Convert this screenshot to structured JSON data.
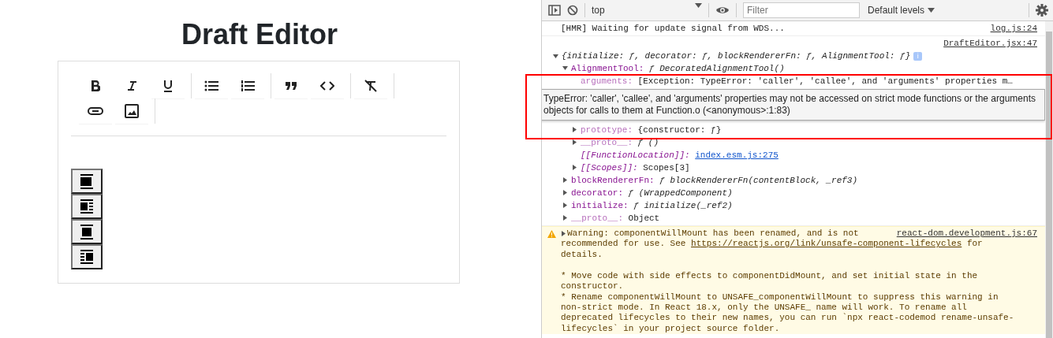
{
  "editor": {
    "title": "Draft Editor",
    "toolbar_rows": [
      [
        [
          {
            "kind": "bold"
          },
          {
            "kind": "italic"
          },
          {
            "kind": "underline"
          }
        ],
        [
          {
            "kind": "bullets"
          },
          {
            "kind": "numbers"
          }
        ],
        [
          {
            "kind": "quote"
          },
          {
            "kind": "code"
          }
        ],
        [
          {
            "kind": "clear"
          }
        ]
      ],
      [
        [
          {
            "kind": "link"
          },
          {
            "kind": "image"
          }
        ]
      ]
    ],
    "align_buttons": [
      {
        "kind": "full"
      },
      {
        "kind": "left"
      },
      {
        "kind": "center"
      },
      {
        "kind": "right"
      }
    ]
  },
  "devtools": {
    "context": "top",
    "filter": {
      "placeholder": "Filter"
    },
    "levels": "Default levels",
    "messages": [
      {
        "kind": "log",
        "text": "[HMR] Waiting for update signal from WDS...",
        "source": "log.js:24"
      },
      {
        "kind": "object",
        "source": "DraftEditor.jsx:47",
        "summary": "{initialize: ƒ, decorator: ƒ, blockRendererFn: ƒ, AlignmentTool: ƒ}",
        "badge": "i",
        "expanded": true,
        "children": [
          {
            "key": "AlignmentTool:",
            "value": "ƒ DecoratedAlignmentTool()",
            "expandable": true,
            "expanded": true,
            "faded": false,
            "kind": "function",
            "children": [
              {
                "key": "arguments:",
                "value": "[Exception: TypeError: 'caller', 'callee', and 'arguments' properties m…",
                "expandable": false,
                "expanded": false,
                "faded": true,
                "kind": "plain",
                "tooltip": "TypeError: 'caller', 'callee', and 'arguments' properties may not be accessed on strict mode functions or the arguments objects for calls to them at Function.o (<anonymous>:1:83)"
              },
              {
                "key": "prototype:",
                "value": "{constructor: ƒ}",
                "expandable": true,
                "expanded": false,
                "faded": true,
                "kind": "plain"
              },
              {
                "key": "__proto__:",
                "value": "ƒ ()",
                "expandable": true,
                "expanded": false,
                "faded": true,
                "kind": "function"
              },
              {
                "key": "[[FunctionLocation]]:",
                "value": "index.esm.js:275",
                "expandable": false,
                "expanded": false,
                "faded": false,
                "kind": "link"
              },
              {
                "key": "[[Scopes]]:",
                "value": "Scopes[3]",
                "expandable": true,
                "expanded": false,
                "faded": false,
                "kind": "plain"
              }
            ]
          },
          {
            "key": "blockRendererFn:",
            "value": "ƒ blockRendererFn(contentBlock, _ref3)",
            "expandable": true,
            "expanded": false,
            "faded": false,
            "kind": "function"
          },
          {
            "key": "decorator:",
            "value": "ƒ (WrappedComponent)",
            "expandable": true,
            "expanded": false,
            "faded": false,
            "kind": "function"
          },
          {
            "key": "initialize:",
            "value": "ƒ initialize(_ref2)",
            "expandable": true,
            "expanded": false,
            "faded": false,
            "kind": "function"
          },
          {
            "key": "__proto__:",
            "value": "Object",
            "expandable": true,
            "expanded": false,
            "faded": true,
            "kind": "plain"
          }
        ]
      },
      {
        "kind": "warning",
        "source": "react-dom.development.js:67",
        "expanded": false,
        "lines": [
          {
            "text": "Warning: componentWillMount has been renamed, and is not",
            "spaced": false
          },
          {
            "text": "recommended for use. See ",
            "link": "https://reactjs.org/link/unsafe-component-lifecycles",
            "after": " for",
            "spaced": false
          },
          {
            "text": "details.",
            "spaced": false
          },
          {
            "text": "* Move code with side effects to componentDidMount, and set initial state in the",
            "spaced": true
          },
          {
            "text": "constructor.",
            "spaced": false
          },
          {
            "text": "* Rename componentWillMount to UNSAFE_componentWillMount to suppress this warning in",
            "spaced": false
          },
          {
            "text": "non-strict mode. In React 18.x, only the UNSAFE_ name will work. To rename all",
            "spaced": false
          },
          {
            "text": "deprecated lifecycles to their new names, you can run `npx react-codemod rename-unsafe-",
            "spaced": false
          },
          {
            "text": "lifecycles` in your project source folder.",
            "spaced": false
          }
        ]
      }
    ]
  }
}
